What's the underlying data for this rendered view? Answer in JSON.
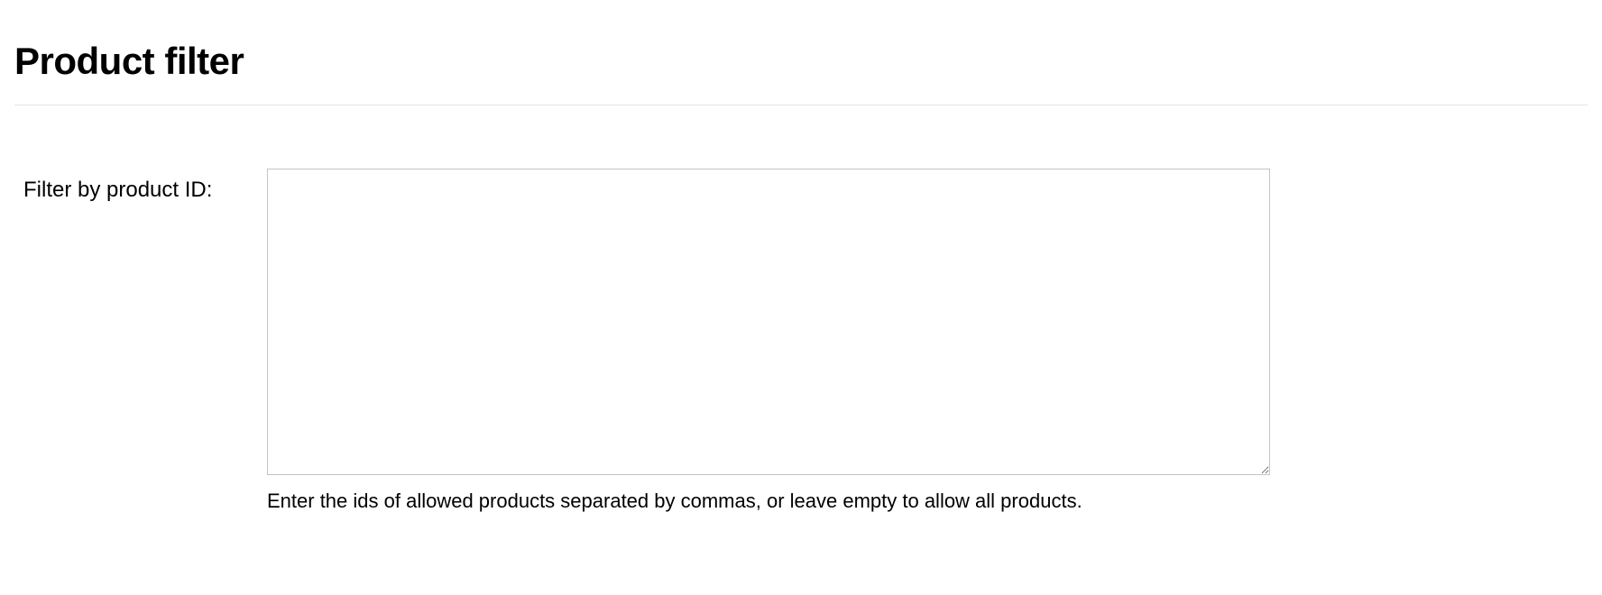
{
  "section": {
    "title": "Product filter"
  },
  "form": {
    "filter_label": "Filter by product ID:",
    "filter_value": "",
    "filter_help": "Enter the ids of allowed products separated by commas, or leave empty to allow all products."
  }
}
